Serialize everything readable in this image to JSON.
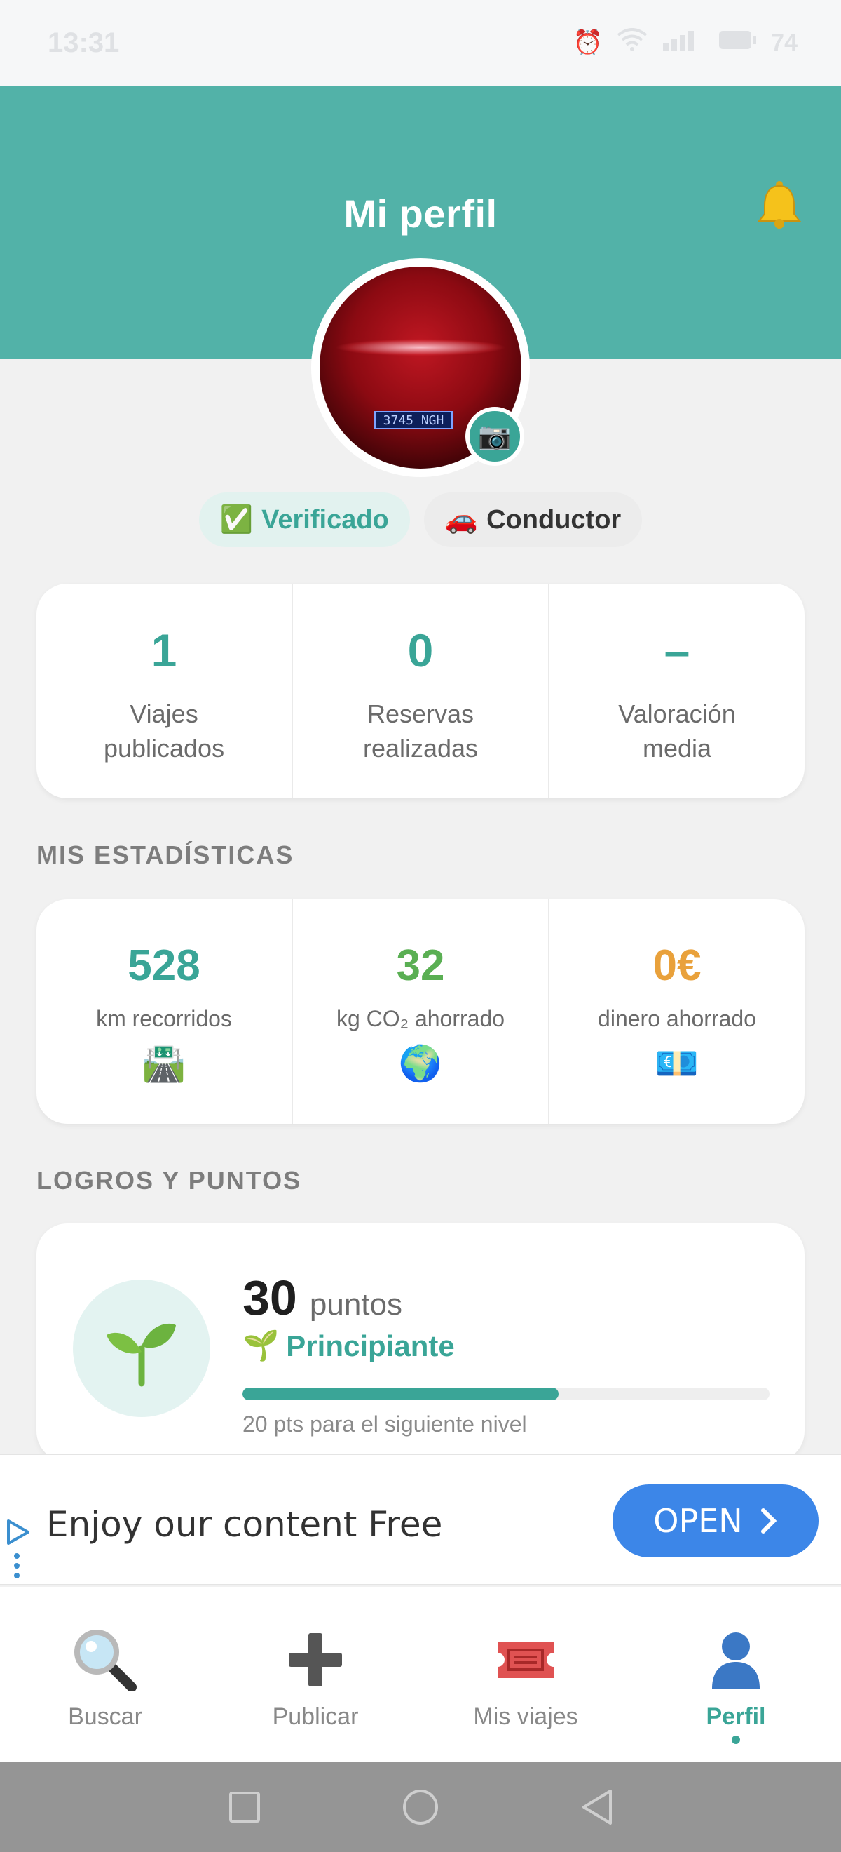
{
  "status_bar": {
    "time": "13:31",
    "battery_percent": "74"
  },
  "header": {
    "title": "Mi perfil"
  },
  "profile": {
    "avatar_plate_text": "3745 NGH",
    "badges": [
      {
        "icon": "✅",
        "label": "Verificado"
      },
      {
        "icon": "🚗",
        "label": "Conductor"
      }
    ]
  },
  "summary": [
    {
      "value": "1",
      "label_line1": "Viajes",
      "label_line2": "publicados"
    },
    {
      "value": "0",
      "label_line1": "Reservas",
      "label_line2": "realizadas"
    },
    {
      "value": "–",
      "label_line1": "Valoración",
      "label_line2": "media"
    }
  ],
  "stats_section_title": "MIS ESTADÍSTICAS",
  "stats": [
    {
      "value": "528",
      "label": "km recorridos",
      "icon": "🛣️",
      "color": "#3aa597"
    },
    {
      "value": "32",
      "label": "kg CO₂ ahorrado",
      "icon": "🌍",
      "color": "#5aaf53"
    },
    {
      "value": "0€",
      "label": "dinero ahorrado",
      "icon": "💶",
      "color": "#e9a13b"
    }
  ],
  "achievements_section_title": "LOGROS Y PUNTOS",
  "points": {
    "value": "30",
    "unit": "puntos",
    "level_icon": "🌱",
    "level": "Principiante",
    "progress_fraction": 0.6,
    "note": "20 pts para el siguiente nivel"
  },
  "ad": {
    "text": "Enjoy our content Free",
    "button_label": "OPEN"
  },
  "bottom_nav": [
    {
      "label": "Buscar",
      "icon": "search-icon"
    },
    {
      "label": "Publicar",
      "icon": "plus-icon"
    },
    {
      "label": "Mis viajes",
      "icon": "ticket-icon"
    },
    {
      "label": "Perfil",
      "icon": "person-icon",
      "active": true
    }
  ],
  "colors": {
    "accent": "#52b2a8",
    "accent_dark": "#3aa597",
    "ad_button": "#3c86e8"
  }
}
